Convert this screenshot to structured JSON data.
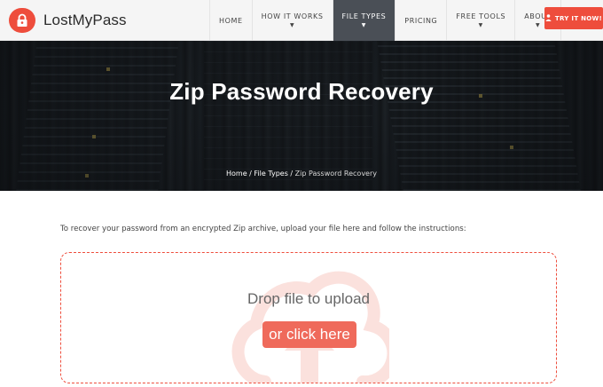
{
  "brand": {
    "name": "LostMyPass"
  },
  "nav": {
    "items": [
      {
        "label": "HOME",
        "has_dropdown": false,
        "active": false
      },
      {
        "label": "HOW IT WORKS",
        "has_dropdown": true,
        "active": false
      },
      {
        "label": "FILE TYPES",
        "has_dropdown": true,
        "active": true
      },
      {
        "label": "PRICING",
        "has_dropdown": false,
        "active": false
      },
      {
        "label": "FREE TOOLS",
        "has_dropdown": true,
        "active": false
      },
      {
        "label": "ABOUT",
        "has_dropdown": true,
        "active": false
      }
    ],
    "cta_label": "TRY IT NOW!",
    "cta_icon": "person-icon"
  },
  "hero": {
    "title": "Zip Password Recovery",
    "breadcrumb": {
      "home": "Home",
      "sep1": " / ",
      "file_types": "File Types",
      "sep2": " / ",
      "current": "Zip Password Recovery"
    }
  },
  "content": {
    "intro": "To recover your password from an encrypted Zip archive, upload your file here and follow the instructions:",
    "dropzone": {
      "prompt": "Drop file to upload",
      "button": "or click here",
      "icon": "cloud-upload-icon"
    }
  },
  "colors": {
    "accent": "#ee4d3c",
    "button": "#ef6a5b",
    "nav_active": "#4a4f56",
    "header_bg": "#f5f5f5"
  }
}
